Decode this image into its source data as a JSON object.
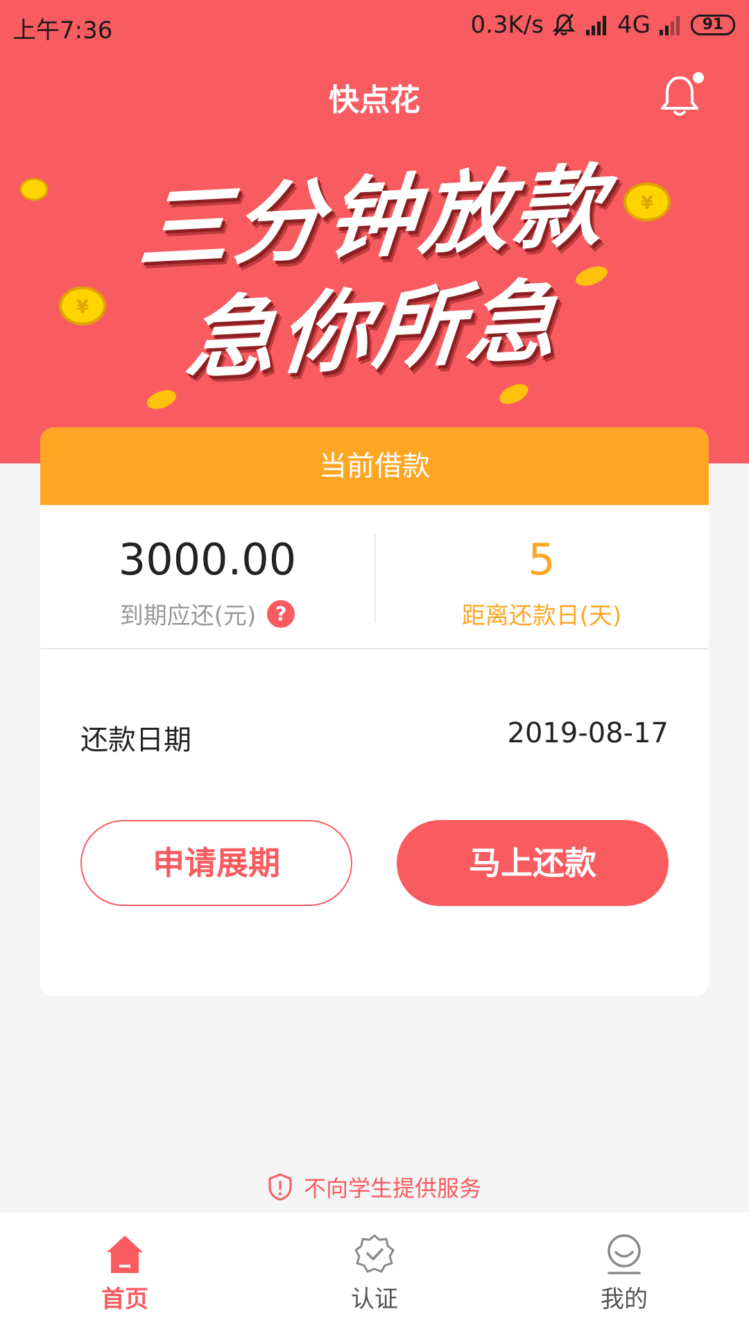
{
  "status_bar": {
    "time": "上午7:36",
    "speed": "0.3K/s",
    "network": "4G",
    "battery": "91"
  },
  "header": {
    "title": "快点花",
    "notification_dot": true
  },
  "banner": {
    "line1": "三分钟放款",
    "line2": "急你所急",
    "coin_symbol": "¥"
  },
  "loan_card": {
    "title": "当前借款",
    "amount": "3000.00",
    "amount_label": "到期应还(元)",
    "help_symbol": "?",
    "days": "5",
    "days_label": "距离还款日(天)",
    "due_date_label": "还款日期",
    "due_date": "2019-08-17",
    "extend_button": "申请展期",
    "repay_button": "马上还款"
  },
  "notice": "不向学生提供服务",
  "tabbar": {
    "items": [
      {
        "label": "首页",
        "icon": "home-icon",
        "active": true
      },
      {
        "label": "认证",
        "icon": "verify-badge-icon",
        "active": false
      },
      {
        "label": "我的",
        "icon": "profile-icon",
        "active": false
      }
    ]
  },
  "colors": {
    "brand_red": "#f85b60",
    "accent_orange": "#ffa624",
    "coin_gold": "#ffd400"
  }
}
